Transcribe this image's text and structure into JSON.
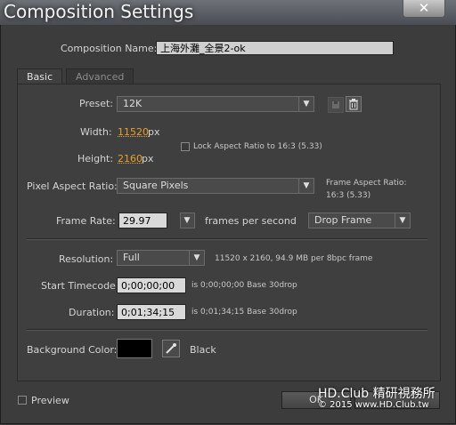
{
  "window": {
    "title": "Composition Settings",
    "close_glyph": "✕"
  },
  "comp_name": {
    "label": "Composition Name:",
    "value": "上海外灘_全景2-ok"
  },
  "tabs": [
    {
      "label": "Basic"
    },
    {
      "label": "Advanced"
    }
  ],
  "preset": {
    "label": "Preset:",
    "value": "12K"
  },
  "width": {
    "label": "Width:",
    "value": "11520",
    "unit": "px"
  },
  "height": {
    "label": "Height:",
    "value": "2160",
    "unit": "px"
  },
  "lock_aspect": {
    "label": "Lock Aspect Ratio to 16:3 (5.33)",
    "checked": false
  },
  "pixel_aspect": {
    "label": "Pixel Aspect Ratio:",
    "value": "Square Pixels"
  },
  "frame_aspect": {
    "label": "Frame Aspect Ratio:",
    "value": "16:3 (5.33)"
  },
  "frame_rate": {
    "label": "Frame Rate:",
    "value": "29.97",
    "suffix": "frames per second",
    "drop_value": "Drop Frame"
  },
  "resolution": {
    "label": "Resolution:",
    "value": "Full",
    "info": "11520 x 2160, 94.9 MB per 8bpc frame"
  },
  "start_timecode": {
    "label": "Start Timecode:",
    "value": "0;00;00;00",
    "info": "is 0;00;00;00  Base 30drop"
  },
  "duration": {
    "label": "Duration:",
    "value": "0;01;34;15",
    "info": "is 0;01;34;15  Base 30drop"
  },
  "background_color": {
    "label": "Background Color:",
    "color_name": "Black",
    "color": "#000000"
  },
  "preview": {
    "label": "Preview",
    "checked": false
  },
  "buttons": {
    "ok": "OK"
  },
  "watermark": {
    "line1": "HD.Club 精研視務所",
    "line2": "© 2015  www.HD.Club.tw"
  },
  "icons": {
    "save_preset": "save-icon",
    "delete_preset": "trash-icon",
    "eyedropper": "eyedropper-icon"
  }
}
